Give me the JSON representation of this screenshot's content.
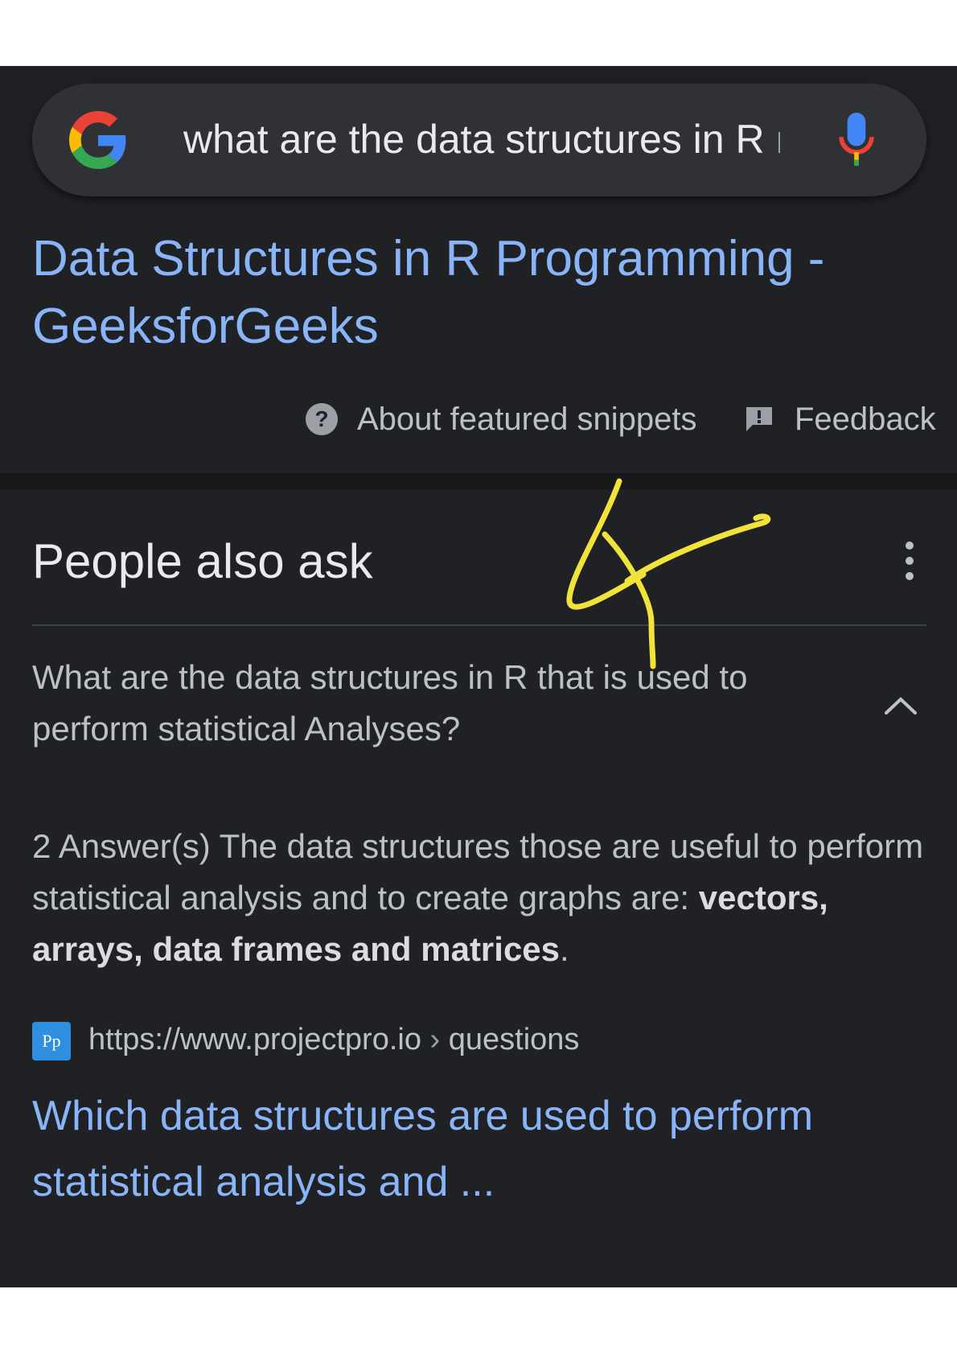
{
  "search": {
    "query": "what are the data structures in R",
    "logo_icon": "google-g-icon",
    "mic_icon": "microphone-icon"
  },
  "featured": {
    "title": "Data Structures in R Programming - GeeksforGeeks",
    "about_label": "About featured snippets",
    "feedback_label": "Feedback"
  },
  "paa": {
    "title": "People also ask",
    "question": "What are the data structures in R that is used to perform statistical Analyses?",
    "answer_prefix": "2 Answer(s) The data structures those are useful to perform statistical analysis and to create graphs are: ",
    "answer_bold": "vectors, arrays, data frames and matrices",
    "answer_suffix": ".",
    "source_icon_text": "Pp",
    "source_url": "https://www.projectpro.io",
    "source_sep": "›",
    "source_path": "questions",
    "link_title": "Which data structures are used to perform statistical analysis and ..."
  },
  "colors": {
    "background": "#202124",
    "link": "#8ab4f8",
    "text": "#bdc1c6",
    "heading": "#e8eaed",
    "annotation": "#f2e33a"
  }
}
